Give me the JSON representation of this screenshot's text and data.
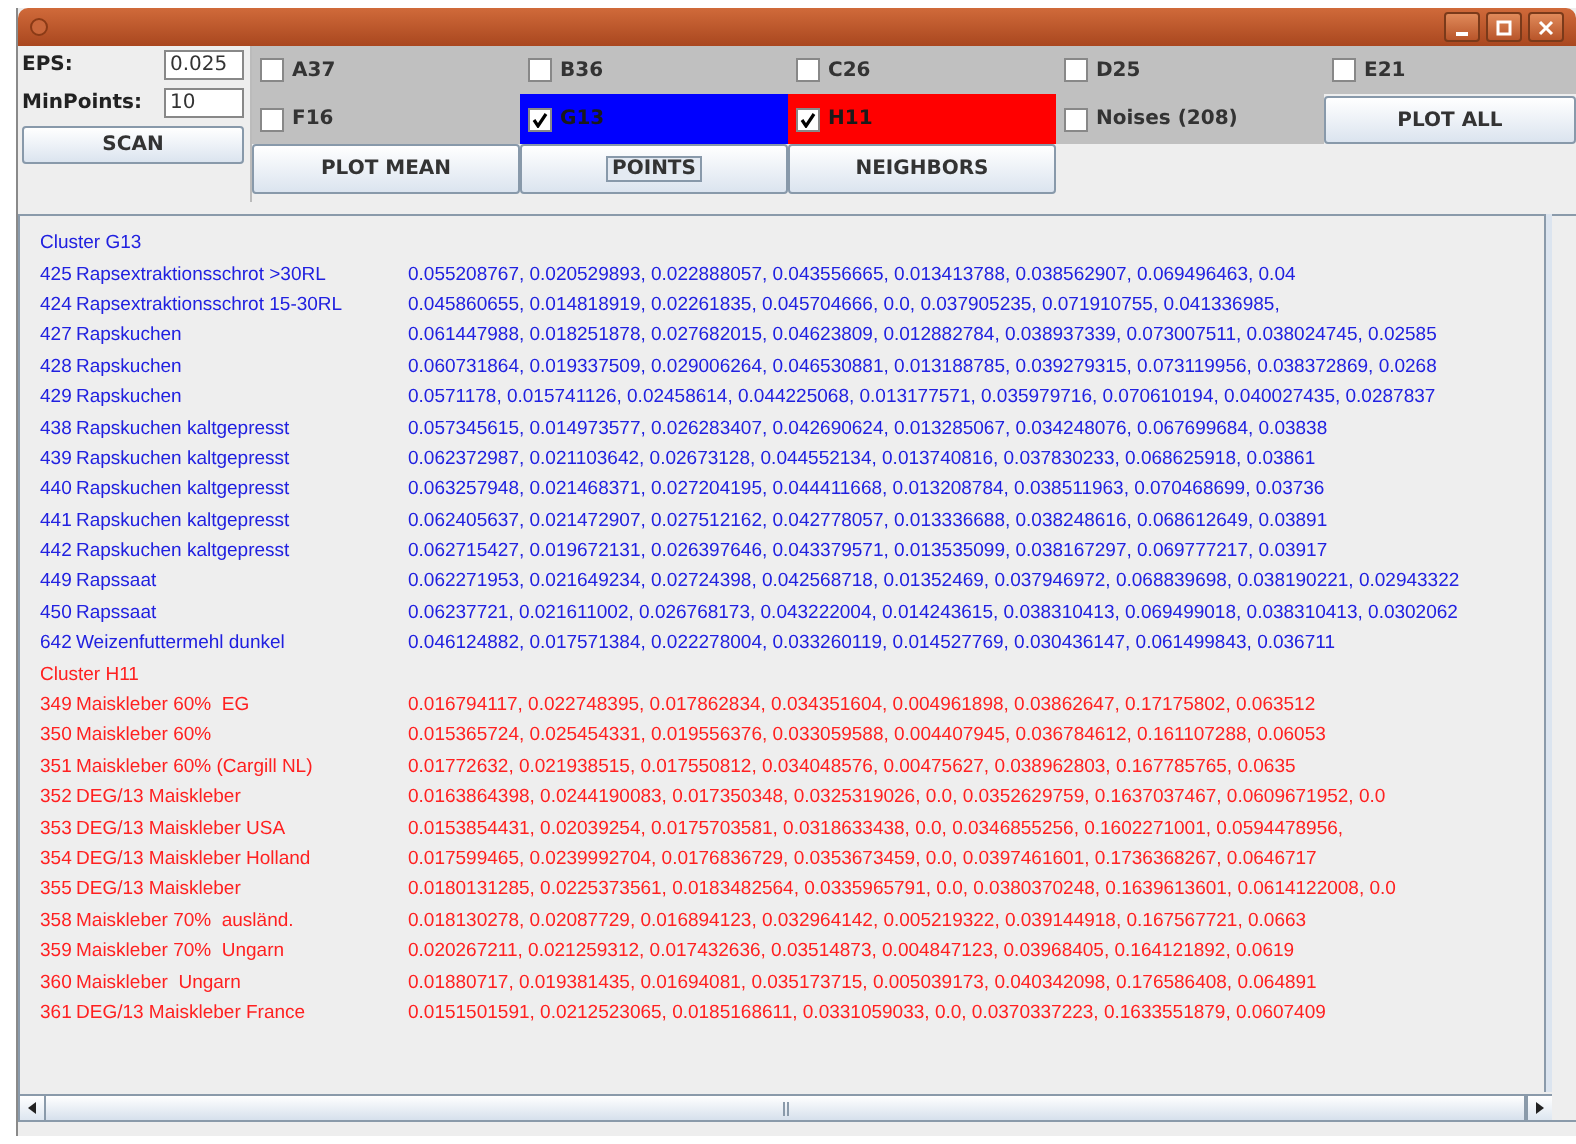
{
  "params": [
    {
      "label": "EPS:",
      "value": "0.025"
    },
    {
      "label": "MinPoints:",
      "value": "10"
    }
  ],
  "scan_button": "SCAN",
  "clusters_toggles": [
    {
      "label": "A37",
      "checked": false
    },
    {
      "label": "B36",
      "checked": false
    },
    {
      "label": "C26",
      "checked": false
    },
    {
      "label": "D25",
      "checked": false
    },
    {
      "label": "E21",
      "checked": false
    },
    {
      "label": "F16",
      "checked": false
    },
    {
      "label": "G13",
      "checked": true,
      "color": "#0000ff"
    },
    {
      "label": "H11",
      "checked": true,
      "color": "#ff0000"
    },
    {
      "label": "Noises (208)",
      "checked": false
    }
  ],
  "plot_all_button": "PLOT ALL",
  "action_buttons": [
    {
      "label": "PLOT MEAN",
      "focused": false
    },
    {
      "label": "POINTS",
      "focused": true
    },
    {
      "label": "NEIGHBORS",
      "focused": false
    }
  ],
  "clusters": [
    {
      "title": "Cluster G13",
      "color": "#2020e0",
      "rows": [
        {
          "id": "425",
          "name": "Rapsextraktionsschrot >30RL",
          "values": "0.055208767, 0.020529893, 0.022888057, 0.043556665, 0.013413788, 0.038562907, 0.069496463, 0.04"
        },
        {
          "id": "424",
          "name": "Rapsextraktionsschrot 15-30RL",
          "values": "0.045860655, 0.014818919, 0.02261835, 0.045704666, 0.0, 0.037905235, 0.071910755, 0.041336985,"
        },
        {
          "id": "427",
          "name": "Rapskuchen",
          "values": "0.061447988, 0.018251878, 0.027682015, 0.04623809, 0.012882784, 0.038937339, 0.073007511, 0.038024745, 0.02585"
        },
        {
          "id": "428",
          "name": "Rapskuchen",
          "values": "0.060731864, 0.019337509, 0.029006264, 0.046530881, 0.013188785, 0.039279315, 0.073119956, 0.038372869, 0.0268"
        },
        {
          "id": "429",
          "name": "Rapskuchen",
          "values": "0.0571178, 0.015741126, 0.02458614, 0.044225068, 0.013177571, 0.035979716, 0.070610194, 0.040027435, 0.0287837"
        },
        {
          "id": "438",
          "name": "Rapskuchen kaltgepresst",
          "values": "0.057345615, 0.014973577, 0.026283407, 0.042690624, 0.013285067, 0.034248076, 0.067699684, 0.03838"
        },
        {
          "id": "439",
          "name": "Rapskuchen kaltgepresst",
          "values": "0.062372987, 0.021103642, 0.02673128, 0.044552134, 0.013740816, 0.037830233, 0.068625918, 0.03861"
        },
        {
          "id": "440",
          "name": "Rapskuchen kaltgepresst",
          "values": "0.063257948, 0.021468371, 0.027204195, 0.044411668, 0.013208784, 0.038511963, 0.070468699, 0.03736"
        },
        {
          "id": "441",
          "name": "Rapskuchen kaltgepresst",
          "values": "0.062405637, 0.021472907, 0.027512162, 0.042778057, 0.013336688, 0.038248616, 0.068612649, 0.03891"
        },
        {
          "id": "442",
          "name": "Rapskuchen kaltgepresst",
          "values": "0.062715427, 0.019672131, 0.026397646, 0.043379571, 0.013535099, 0.038167297, 0.069777217, 0.03917"
        },
        {
          "id": "449",
          "name": "Rapssaat",
          "values": "0.062271953, 0.021649234, 0.02724398, 0.042568718, 0.01352469, 0.037946972, 0.068839698, 0.038190221, 0.02943322"
        },
        {
          "id": "450",
          "name": "Rapssaat",
          "values": "0.06237721, 0.021611002, 0.026768173, 0.043222004, 0.014243615, 0.038310413, 0.069499018, 0.038310413, 0.0302062"
        },
        {
          "id": "642",
          "name": "Weizenfuttermehl dunkel",
          "values": "0.046124882, 0.017571384, 0.022278004, 0.033260119, 0.014527769, 0.030436147, 0.061499843, 0.036711"
        }
      ]
    },
    {
      "title": "Cluster H11",
      "color": "#ff2020",
      "rows": [
        {
          "id": "349",
          "name": "Maiskleber 60%  EG",
          "values": "0.016794117, 0.022748395, 0.017862834, 0.034351604, 0.004961898, 0.03862647, 0.17175802, 0.063512"
        },
        {
          "id": "350",
          "name": "Maiskleber 60%",
          "values": "0.015365724, 0.025454331, 0.019556376, 0.033059588, 0.004407945, 0.036784612, 0.161107288, 0.06053"
        },
        {
          "id": "351",
          "name": "Maiskleber 60% (Cargill NL)",
          "values": "0.01772632, 0.021938515, 0.017550812, 0.034048576, 0.00475627, 0.038962803, 0.167785765, 0.0635"
        },
        {
          "id": "352",
          "name": "DEG/13 Maiskleber",
          "values": "0.0163864398, 0.0244190083, 0.017350348, 0.0325319026, 0.0, 0.0352629759, 0.1637037467, 0.0609671952, 0.0"
        },
        {
          "id": "353",
          "name": "DEG/13 Maiskleber USA",
          "values": "0.0153854431, 0.02039254, 0.0175703581, 0.0318633438, 0.0, 0.0346855256, 0.1602271001, 0.0594478956,"
        },
        {
          "id": "354",
          "name": "DEG/13 Maiskleber Holland",
          "values": "0.017599465, 0.0239992704, 0.0176836729, 0.0353673459, 0.0, 0.0397461601, 0.1736368267, 0.0646717"
        },
        {
          "id": "355",
          "name": "DEG/13 Maiskleber",
          "values": "0.0180131285, 0.0225373561, 0.0183482564, 0.0335965791, 0.0, 0.0380370248, 0.1639613601, 0.0614122008, 0.0"
        },
        {
          "id": "358",
          "name": "Maiskleber 70%  ausländ.",
          "values": "0.018130278, 0.02087729, 0.016894123, 0.032964142, 0.005219322, 0.039144918, 0.167567721, 0.0663"
        },
        {
          "id": "359",
          "name": "Maiskleber 70%  Ungarn",
          "values": "0.020267211, 0.021259312, 0.017432636, 0.03514873, 0.004847123, 0.03968405, 0.164121892, 0.0619"
        },
        {
          "id": "360",
          "name": "Maiskleber  Ungarn",
          "values": "0.01880717, 0.019381435, 0.01694081, 0.035173715, 0.005039173, 0.040342098, 0.176586408, 0.064891"
        },
        {
          "id": "361",
          "name": "DEG/13 Maiskleber France",
          "values": "0.0151501591, 0.0212523065, 0.0185168611, 0.0331059033, 0.0, 0.0370337223, 0.1633551879, 0.0607409"
        }
      ]
    }
  ]
}
